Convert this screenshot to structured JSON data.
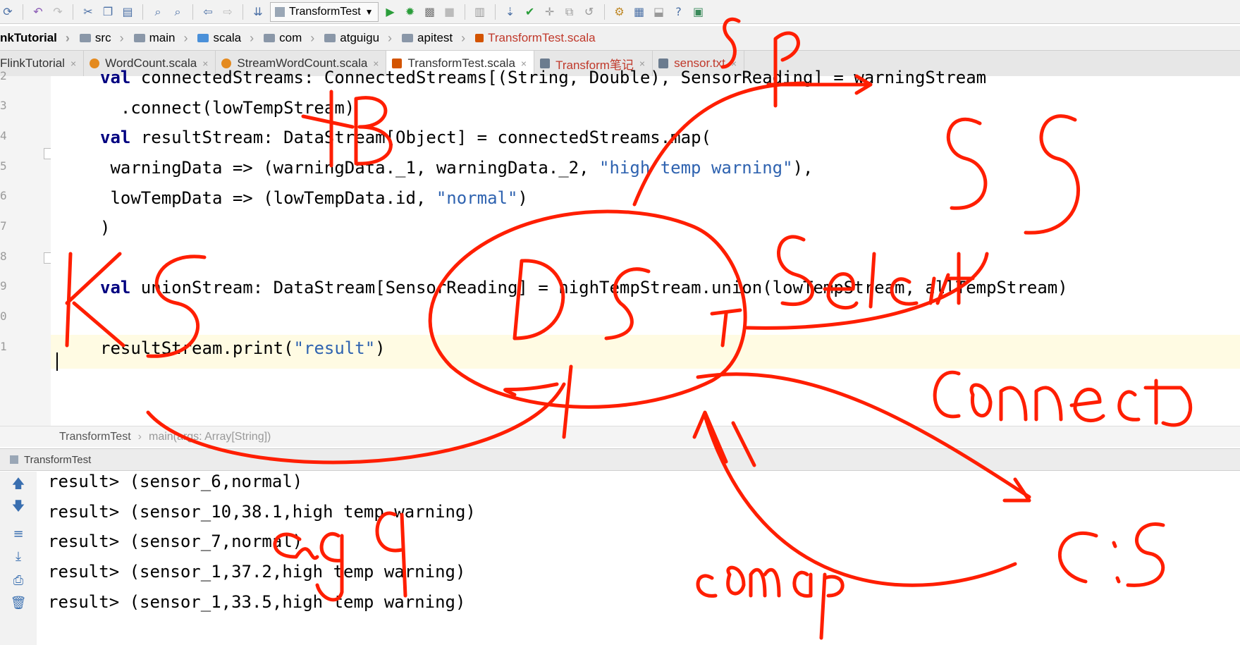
{
  "toolbar": {
    "run_config": "TransformTest",
    "icons": [
      "sync-icon",
      "undo-icon",
      "redo-icon",
      "cut-icon",
      "copy-icon",
      "paste-icon",
      "find-icon",
      "replace-icon",
      "back-icon",
      "forward-icon",
      "build-icon",
      "run-icon",
      "debug-icon",
      "coverage-icon",
      "stop-icon",
      "structure-icon",
      "vcs-update-icon",
      "vcs-commit-icon",
      "vcs-push-icon",
      "vcs-compare-icon",
      "vcs-revert-icon",
      "settings-icon",
      "project-structure-icon",
      "sdk-icon",
      "help-icon",
      "plugin-icon"
    ]
  },
  "breadcrumb": [
    "nkTutorial",
    "src",
    "main",
    "scala",
    "com",
    "atguigu",
    "apitest",
    "TransformTest.scala"
  ],
  "tabs": [
    {
      "label": "FlinkTutorial"
    },
    {
      "label": "WordCount.scala"
    },
    {
      "label": "StreamWordCount.scala"
    },
    {
      "label": "TransformTest.scala"
    },
    {
      "label": "Transform笔记"
    },
    {
      "label": "sensor.txt"
    }
  ],
  "gutter_numbers": [
    "2",
    "3",
    "4",
    "5",
    "6",
    "7",
    "8",
    "9",
    "0",
    "1"
  ],
  "code": {
    "l1_kw": "val",
    "l1_rest": " connectedStreams: ConnectedStreams[(String, Double), SensorReading] = warningStream",
    "l2": "  .connect(lowTempStream)",
    "l3_kw": "val",
    "l3_rest": " resultStream: DataStream[Object] = connectedStreams.map(",
    "l4_a": " warningData => (warningData._1, warningData._2, ",
    "l4_str": "\"high temp warning\"",
    "l4_b": "),",
    "l5_a": " lowTempData => (lowTempData.id, ",
    "l5_str": "\"normal\"",
    "l5_b": ")",
    "l6": ")",
    "l7_kw": "val",
    "l7_rest": " unionStream: DataStream[SensorReading] = highTempStream.union(lowTempStream, allTempStream)",
    "l8_a": "resultStream.print(",
    "l8_str": "\"result\"",
    "l8_b": ")"
  },
  "editor_breadcrumb": {
    "object": "TransformTest",
    "method": "main(args: Array[String])"
  },
  "run_panel": {
    "title": "TransformTest"
  },
  "console_lines": [
    "result> (sensor_6,normal)",
    "result> (sensor_10,38.1,high temp warning)",
    "result> (sensor_7,normal)",
    "result> (sensor_1,37.2,high temp warning)",
    "result> (sensor_1,33.5,high temp warning)"
  ],
  "annotations": [
    "SP",
    "KB",
    "SS",
    "Select",
    "KS",
    "DS",
    "Connect",
    "agg",
    "comap",
    "CS"
  ],
  "colors": {
    "annotation": "#ff1e00",
    "keyword": "#000080",
    "string": "#2f63b0",
    "current_line": "#fffbe3"
  }
}
